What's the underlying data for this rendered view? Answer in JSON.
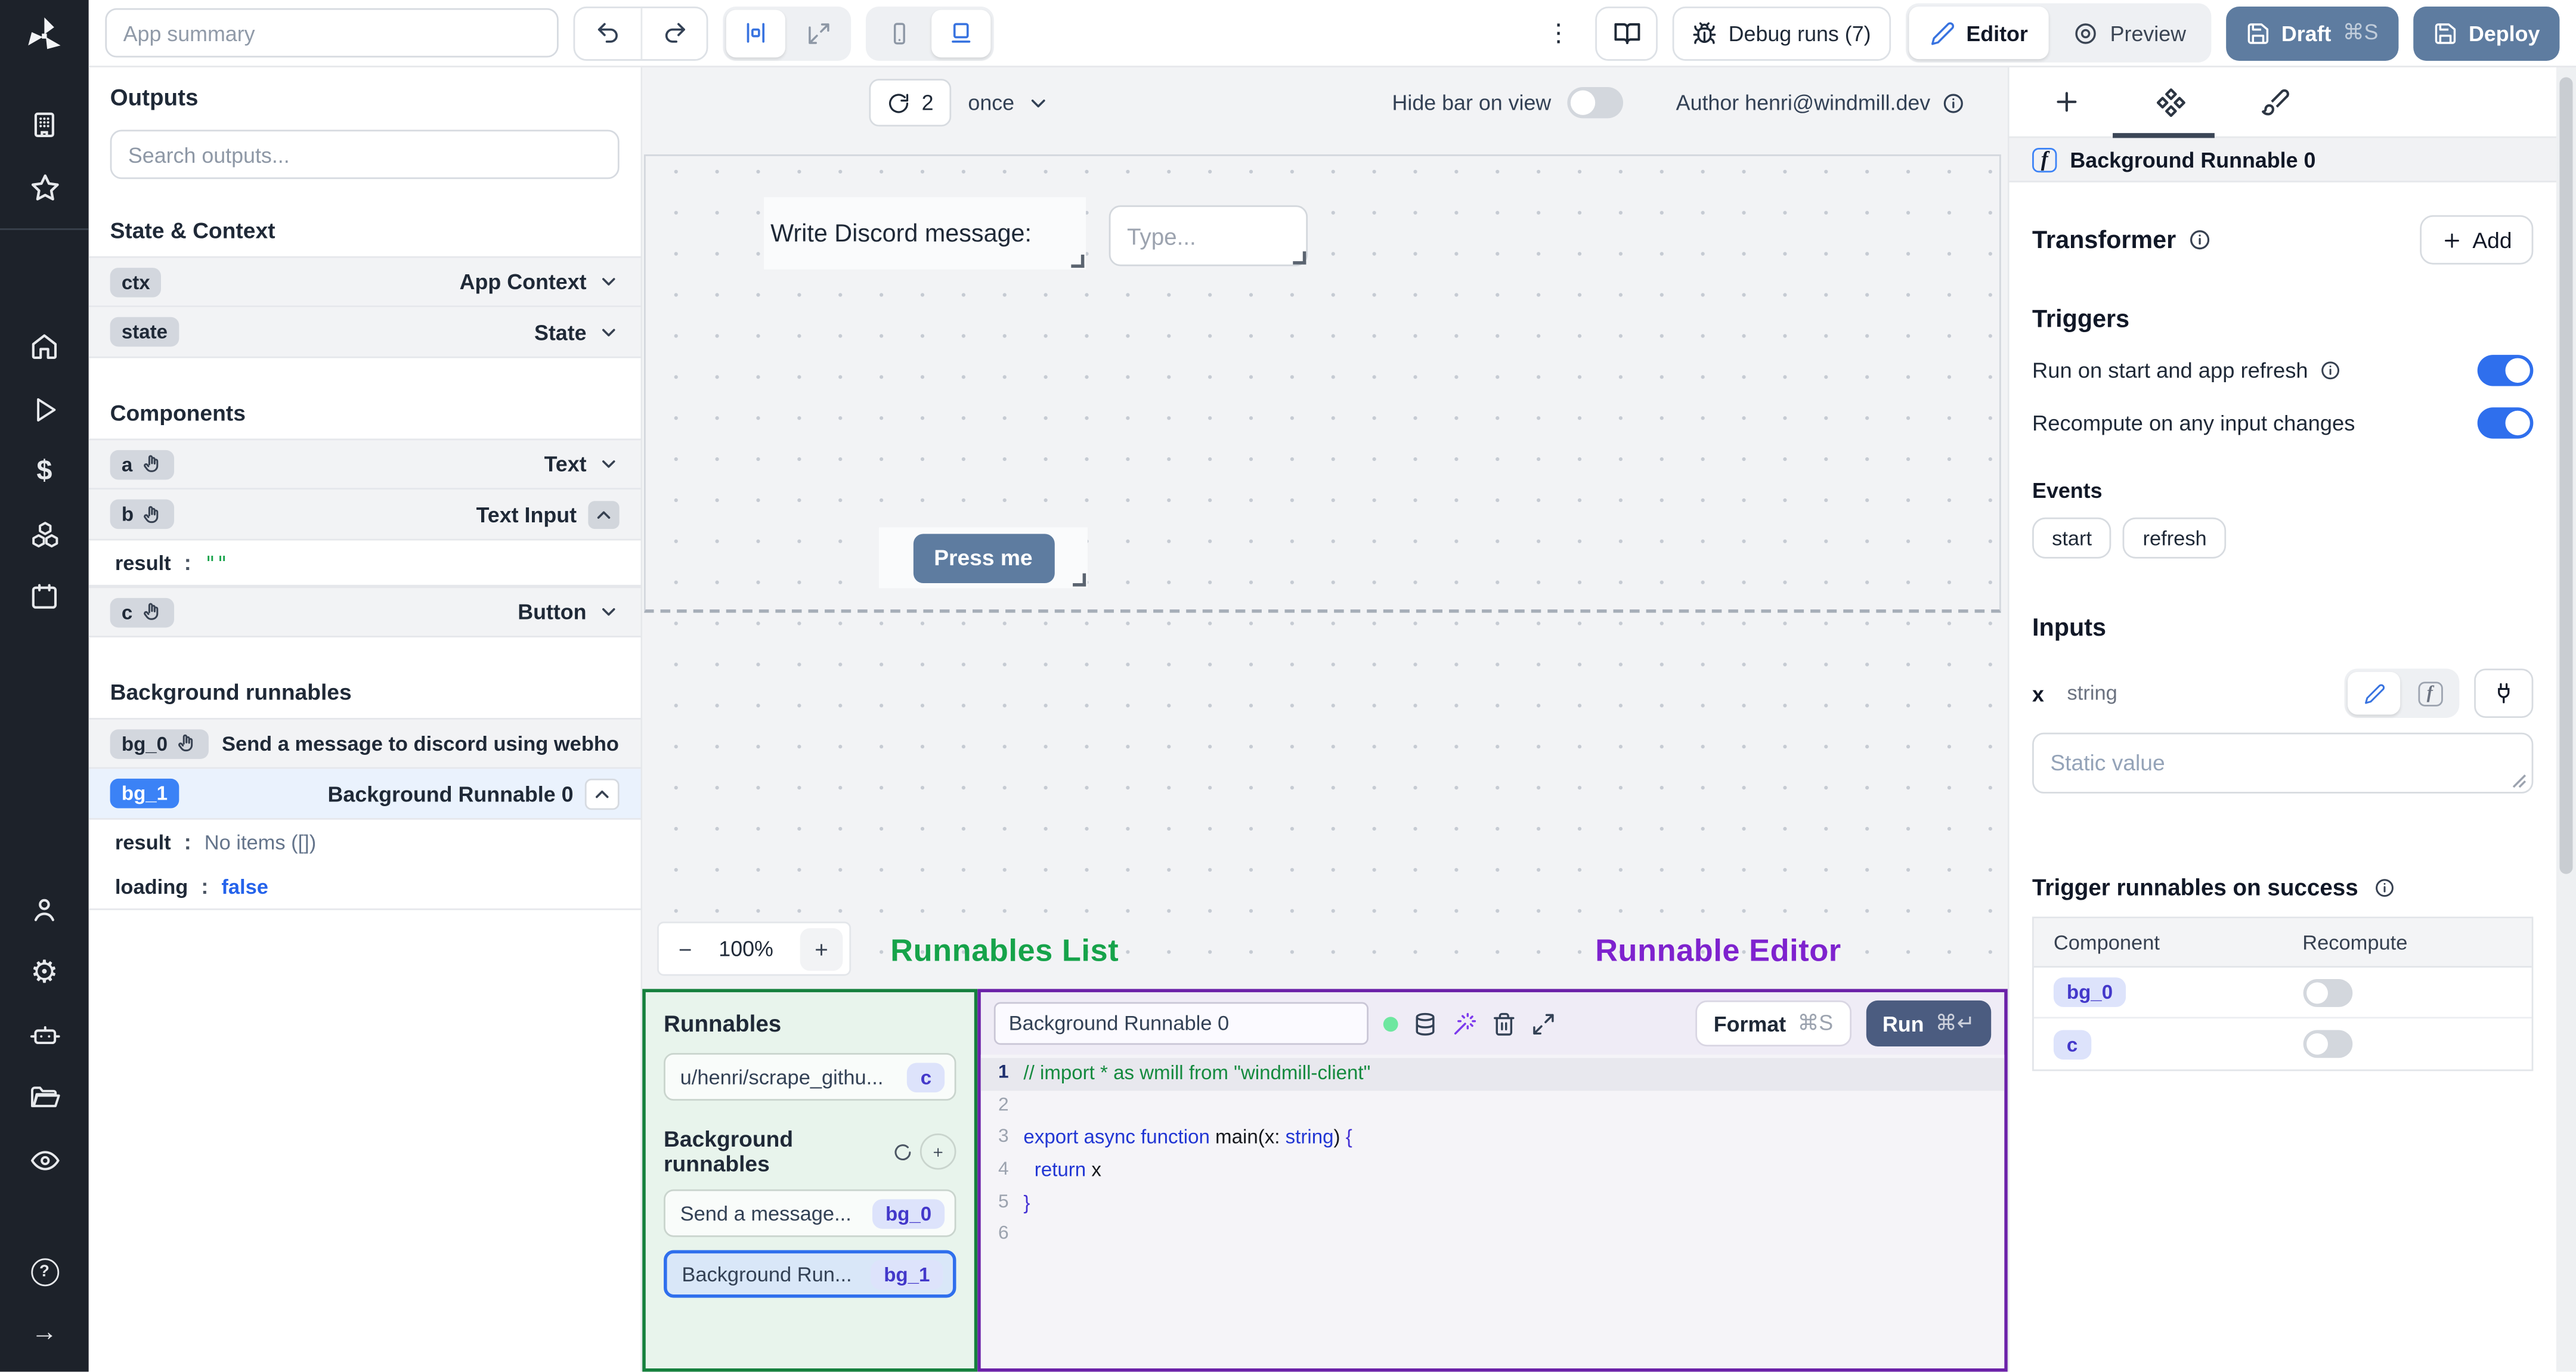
{
  "topbar": {
    "summary_placeholder": "App summary",
    "debug_label": "Debug runs (7)",
    "editor_label": "Editor",
    "preview_label": "Preview",
    "draft_label": "Draft",
    "draft_kbd": "⌘S",
    "deploy_label": "Deploy",
    "kebab": "⋮"
  },
  "rail_icons": [
    "windmill-logo",
    "building",
    "star",
    "home",
    "play",
    "dollar-sign",
    "boxes",
    "calendar",
    "user",
    "settings-gear",
    "robot",
    "folder-open",
    "eye",
    "help-circle",
    "arrow-right"
  ],
  "outputs": {
    "title": "Outputs",
    "search_placeholder": "Search outputs...",
    "section_state": "State & Context",
    "section_components": "Components",
    "section_bg": "Background runnables",
    "ctx": {
      "id": "ctx",
      "type": "App Context"
    },
    "state": {
      "id": "state",
      "type": "State"
    },
    "a": {
      "id": "a",
      "type": "Text"
    },
    "b": {
      "id": "b",
      "type": "Text Input"
    },
    "b_result": {
      "key": "result",
      "colon": ":",
      "val": "\"\""
    },
    "c": {
      "id": "c",
      "type": "Button"
    },
    "bg0": {
      "id": "bg_0",
      "title": "Send a message to discord using webhoo"
    },
    "bg1": {
      "id": "bg_1",
      "type": "Background Runnable 0"
    },
    "bg1_result": {
      "key": "result",
      "colon": ":",
      "val": "No items ([])"
    },
    "bg1_loading": {
      "key": "loading",
      "colon": ":",
      "val": "false"
    }
  },
  "canvas": {
    "refresh_count": "2",
    "schedule": "once",
    "hide_bar_label": "Hide bar on view",
    "author_label": "Author henri@windmill.dev",
    "text_component": "Write Discord message:",
    "input_placeholder": "Type...",
    "button_label": "Press me",
    "zoom_minus": "−",
    "zoom_value": "100%",
    "zoom_plus": "+",
    "label_runnables": "Runnables List",
    "label_editor": "Runnable Editor"
  },
  "runnables_panel": {
    "title": "Runnables",
    "item1": {
      "name": "u/henri/scrape_githu...",
      "badge": "c"
    },
    "bg_title": "Background runnables",
    "item2": {
      "name": "Send a message...",
      "badge": "bg_0"
    },
    "item3": {
      "name": "Background Run...",
      "badge": "bg_1"
    }
  },
  "editor": {
    "name_value": "Background Runnable 0",
    "format_label": "Format",
    "format_kbd": "⌘S",
    "run_label": "Run",
    "run_kbd": "⌘↵",
    "gutter": [
      "1",
      "2",
      "3",
      "4",
      "5",
      "6"
    ],
    "code": {
      "l1": "// import * as wmill from \"windmill-client\"",
      "l3_kw": "export async function ",
      "l3_name": "main",
      "l3_p1": "(",
      "l3_x": "x",
      "l3_colon": ": ",
      "l3_type": "string",
      "l3_p2": ") ",
      "l3_brace": "{",
      "l4_kw": "return",
      "l4_x": " x",
      "l5": "}"
    }
  },
  "right_panel": {
    "selected_label": "Background Runnable 0",
    "transformer_title": "Transformer",
    "add_label": "Add",
    "triggers_title": "Triggers",
    "run_on_start": "Run on start and app refresh",
    "recompute_any": "Recompute on any input changes",
    "events_label": "Events",
    "event1": "start",
    "event2": "refresh",
    "inputs_title": "Inputs",
    "input_name": "x",
    "input_type": "string",
    "static_placeholder": "Static value",
    "success_title": "Trigger runnables on success",
    "col_component": "Component",
    "col_recompute": "Recompute",
    "row1_badge": "bg_0",
    "row2_badge": "c"
  },
  "colors": {
    "accent_blue": "#3b82f6",
    "toggle_on": "#2f6fed",
    "slate_button": "#5e7ca0",
    "run_button": "#4b5c80",
    "green_label": "#16a34a",
    "green_border": "#15803d",
    "purple_label": "#7e22ce",
    "purple_border": "#6b21a8",
    "badge_indigo_bg": "#dde3fb",
    "badge_indigo_text": "#4338ca",
    "rail_bg": "#1d222a"
  },
  "icon_map": {
    "undo-icon": "↶",
    "redo-icon": "↷",
    "kebab-icon": "⋮",
    "cmd-key": "⌘",
    "return-key": "↵",
    "dollar-icon": "$",
    "settings-gear-icon": "⚙",
    "arrow-right-icon": "→",
    "help-icon": "?",
    "hand-pointer-icon": "svg",
    "chevron-down-icon": "svg",
    "chevron-up-icon": "svg",
    "refresh-icon": "svg",
    "info-icon": "svg",
    "book-open-icon": "svg",
    "bug-icon": "svg",
    "pencil-icon": "svg",
    "eye-icon": "svg",
    "save-icon": "svg",
    "database-icon": "svg",
    "wand-icon": "svg",
    "trash-icon": "svg",
    "expand-icon": "svg",
    "plug-icon": "svg",
    "brush-icon": "svg",
    "component-icon": "svg",
    "plus-icon": "svg"
  }
}
